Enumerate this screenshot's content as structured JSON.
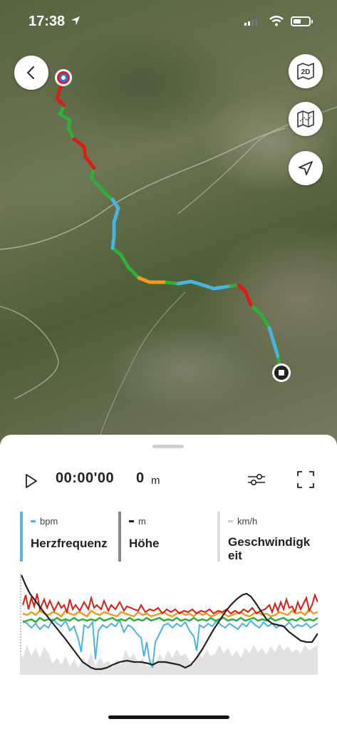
{
  "status_bar": {
    "time": "17:38",
    "icons": [
      "location-arrow-icon",
      "signal-icon",
      "wifi-icon",
      "battery-icon"
    ]
  },
  "map": {
    "buttons": {
      "back": "chevron-left-icon",
      "view_2d": "2D",
      "map_style": "map-fold-icon",
      "locate": "navigation-arrow-icon"
    },
    "start_marker": "start-marker-icon",
    "end_marker": "stop-marker-icon"
  },
  "playback": {
    "time": "00:00'00",
    "distance_value": "0",
    "distance_unit": "m"
  },
  "metrics": [
    {
      "unit": "bpm",
      "name": "Herzfrequenz",
      "color": "#4bb4de"
    },
    {
      "unit": "m",
      "name": "Höhe",
      "color": "#222222"
    },
    {
      "unit": "km/h",
      "name": "Geschwindigk eit",
      "color": "#cccccc"
    }
  ],
  "colors": {
    "heart_red": "#d91e18",
    "heart_orange": "#f29a1f",
    "heart_yellow": "#e8d21d",
    "heart_green": "#2fae3a",
    "heart_blue": "#4bb4de",
    "elevation": "#222222",
    "speed": "#e2e2e2"
  }
}
